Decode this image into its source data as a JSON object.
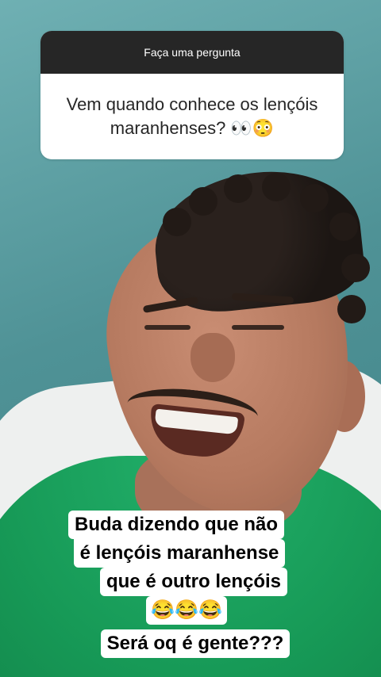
{
  "question_sticker": {
    "header": "Faça uma pergunta",
    "question": "Vem quando conhece os lençóis maranhenses? 👀😳"
  },
  "caption": {
    "line1": "Buda dizendo que não",
    "line2": "é lençóis maranhense",
    "line3": "que é outro lençóis",
    "line4": "😂😂😂",
    "line5": "Será oq é gente???"
  },
  "colors": {
    "sticker_header": "#262626",
    "sticker_body": "#ffffff",
    "wall": "#5fa3a6",
    "shirt": "#179a57"
  }
}
